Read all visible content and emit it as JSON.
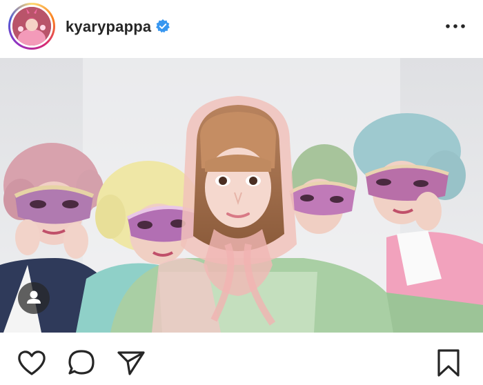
{
  "post": {
    "username": "kyarypappa",
    "verified": true
  },
  "icons": {
    "verified": "verified-badge-icon",
    "more": "more-options-icon",
    "user_tag": "user-tag-icon",
    "like": "heart-icon",
    "comment": "comment-icon",
    "share": "paper-plane-icon",
    "save": "bookmark-icon"
  },
  "colors": {
    "verified_blue": "#3897f0",
    "text": "#262626",
    "background": "#ffffff"
  }
}
